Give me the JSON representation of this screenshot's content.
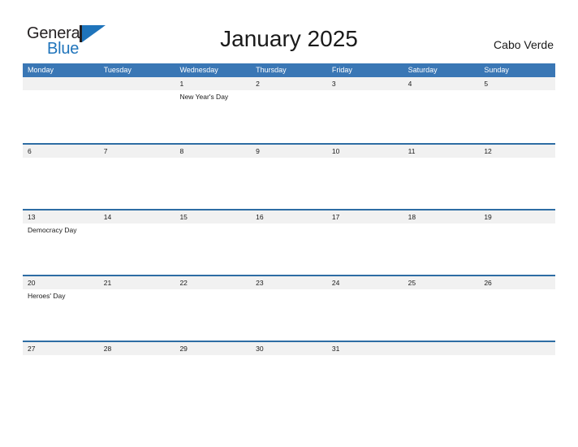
{
  "brand": {
    "name_part1": "General",
    "name_part2": "Blue",
    "flag_icon": "blue-triangle-flag-icon",
    "color_dark": "#231f20",
    "color_blue": "#1f74bb"
  },
  "header": {
    "title": "January 2025",
    "region": "Cabo Verde"
  },
  "calendar": {
    "accent_color": "#3a77b5",
    "row_border_color": "#2e6da4",
    "date_band_color": "#f1f1f1",
    "weekdays": [
      "Monday",
      "Tuesday",
      "Wednesday",
      "Thursday",
      "Friday",
      "Saturday",
      "Sunday"
    ],
    "weeks": [
      {
        "days": [
          {
            "date": "",
            "events": []
          },
          {
            "date": "",
            "events": []
          },
          {
            "date": "1",
            "events": [
              "New Year's Day"
            ]
          },
          {
            "date": "2",
            "events": []
          },
          {
            "date": "3",
            "events": []
          },
          {
            "date": "4",
            "events": []
          },
          {
            "date": "5",
            "events": []
          }
        ]
      },
      {
        "days": [
          {
            "date": "6",
            "events": []
          },
          {
            "date": "7",
            "events": []
          },
          {
            "date": "8",
            "events": []
          },
          {
            "date": "9",
            "events": []
          },
          {
            "date": "10",
            "events": []
          },
          {
            "date": "11",
            "events": []
          },
          {
            "date": "12",
            "events": []
          }
        ]
      },
      {
        "days": [
          {
            "date": "13",
            "events": [
              "Democracy Day"
            ]
          },
          {
            "date": "14",
            "events": []
          },
          {
            "date": "15",
            "events": []
          },
          {
            "date": "16",
            "events": []
          },
          {
            "date": "17",
            "events": []
          },
          {
            "date": "18",
            "events": []
          },
          {
            "date": "19",
            "events": []
          }
        ]
      },
      {
        "days": [
          {
            "date": "20",
            "events": [
              "Heroes' Day"
            ]
          },
          {
            "date": "21",
            "events": []
          },
          {
            "date": "22",
            "events": []
          },
          {
            "date": "23",
            "events": []
          },
          {
            "date": "24",
            "events": []
          },
          {
            "date": "25",
            "events": []
          },
          {
            "date": "26",
            "events": []
          }
        ]
      },
      {
        "days": [
          {
            "date": "27",
            "events": []
          },
          {
            "date": "28",
            "events": []
          },
          {
            "date": "29",
            "events": []
          },
          {
            "date": "30",
            "events": []
          },
          {
            "date": "31",
            "events": []
          },
          {
            "date": "",
            "events": []
          },
          {
            "date": "",
            "events": []
          }
        ]
      }
    ]
  }
}
